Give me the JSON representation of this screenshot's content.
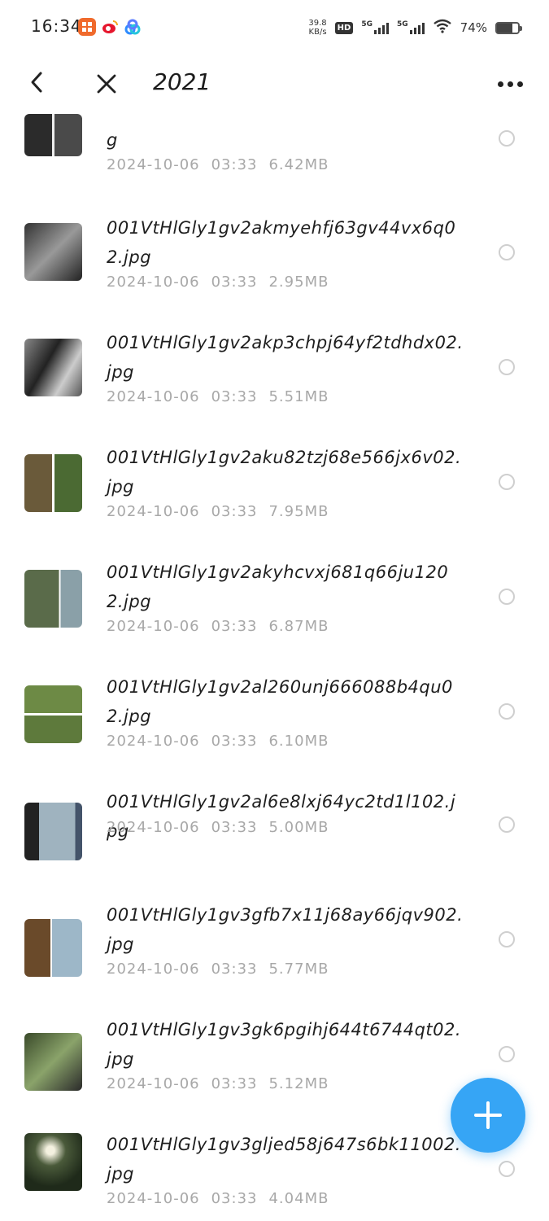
{
  "status_bar": {
    "time": "16:34",
    "speed_value": "39.8",
    "speed_unit": "KB/s",
    "hd_label": "HD",
    "net1": "5G",
    "net2": "5G",
    "battery_pct": "74%",
    "battery_level": 0.74,
    "icons": [
      "app-orange-icon",
      "weibo-icon",
      "baidu-netdisk-icon",
      "hd-icon",
      "signal-icon",
      "wifi-icon",
      "battery-icon"
    ]
  },
  "header": {
    "title": "2021",
    "back_icon": "chevron-left-icon",
    "close_icon": "close-icon",
    "more_icon": "more-horizontal-icon"
  },
  "files": [
    {
      "name": "g",
      "date": "2024-10-06",
      "time": "03:33",
      "size": "6.42MB"
    },
    {
      "name": "001VtHlGly1gv2akmyehfj63gv44vx6q02.jpg",
      "date": "2024-10-06",
      "time": "03:33",
      "size": "2.95MB"
    },
    {
      "name": "001VtHlGly1gv2akp3chpj64yf2tdhdx02.jpg",
      "date": "2024-10-06",
      "time": "03:33",
      "size": "5.51MB"
    },
    {
      "name": "001VtHlGly1gv2aku82tzj68e566jx6v02.jpg",
      "date": "2024-10-06",
      "time": "03:33",
      "size": "7.95MB"
    },
    {
      "name": "001VtHlGly1gv2akyhcvxj681q66ju1202.jpg",
      "date": "2024-10-06",
      "time": "03:33",
      "size": "6.87MB"
    },
    {
      "name": "001VtHlGly1gv2al260unj666088b4qu02.jpg",
      "date": "2024-10-06",
      "time": "03:33",
      "size": "6.10MB"
    },
    {
      "name": "001VtHlGly1gv2al6e8lxj64yc2td1l102.jpg",
      "date": "2024-10-06",
      "time": "03:33",
      "size": "5.00MB"
    },
    {
      "name": "001VtHlGly1gv3gfb7x11j68ay66jqv902.jpg",
      "date": "2024-10-06",
      "time": "03:33",
      "size": "5.77MB"
    },
    {
      "name": "001VtHlGly1gv3gk6pgihj644t6744qt02.jpg",
      "date": "2024-10-06",
      "time": "03:33",
      "size": "5.12MB"
    },
    {
      "name": "001VtHlGly1gv3gljed58j647s6bk11002.jpg",
      "date": "2024-10-06",
      "time": "03:33",
      "size": "4.04MB"
    }
  ],
  "fab": {
    "icon": "plus-icon",
    "color": "#36a5f5"
  },
  "colors": {
    "meta_text": "#a8a8a8",
    "radio_border": "#cfcfcf"
  }
}
